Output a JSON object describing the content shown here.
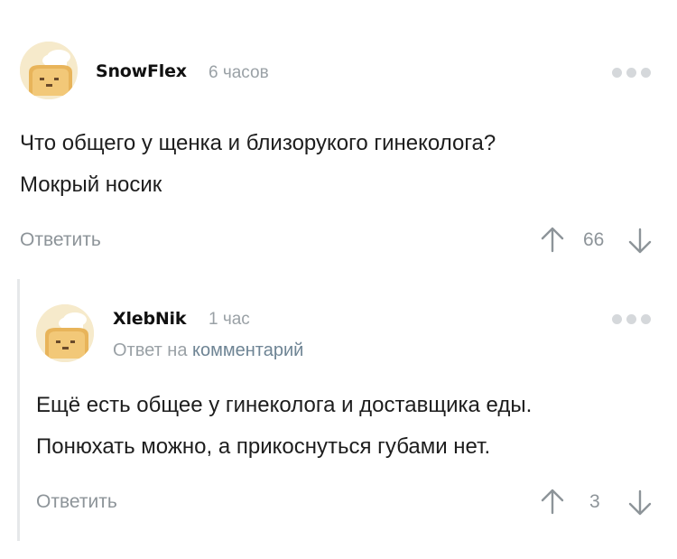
{
  "comments": [
    {
      "username": "SnowFlex",
      "time": "6 часов",
      "lines": [
        "Что общего у щенка и близорукого гинеколога?",
        "Мокрый носик"
      ],
      "reply_label": "Ответить",
      "rating": "66"
    },
    {
      "username": "XlebNik",
      "time": "1 час",
      "reply_to_prefix": "Ответ на",
      "reply_to_link": "комментарий",
      "lines": [
        "Ещё есть общее у гинеколога и доставщика еды.",
        "Понюхать можно, а прикоснуться губами нет."
      ],
      "reply_label": "Ответить",
      "rating": "3"
    }
  ],
  "icons": {
    "menu": "more-dots-icon",
    "up": "arrow-up-icon",
    "down": "arrow-down-icon",
    "avatar": "toast-chef-avatar"
  },
  "colors": {
    "muted": "#8d9499",
    "link": "#6e8494",
    "dots": "#d5d8db"
  }
}
